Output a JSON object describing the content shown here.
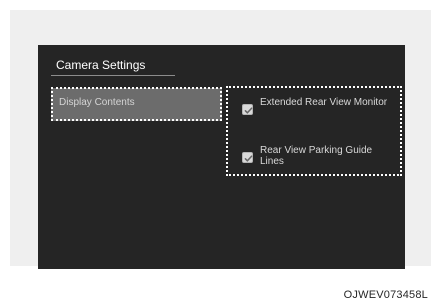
{
  "screen": {
    "title": "Camera Settings",
    "left_menu": {
      "selected_item": "Display Contents"
    },
    "options": [
      {
        "label": "Extended Rear View Monitor",
        "checked": true
      },
      {
        "label": "Rear View Parking Guide Lines",
        "checked": true
      }
    ]
  },
  "figure_code": "OJWEV073458L",
  "colors": {
    "frame": "#efefef",
    "screen": "#252525",
    "selected_item": "#6c6c6c",
    "text": "#ffffff",
    "muted_text": "#d8d8d8",
    "checkbox": "#d9d9d9"
  }
}
